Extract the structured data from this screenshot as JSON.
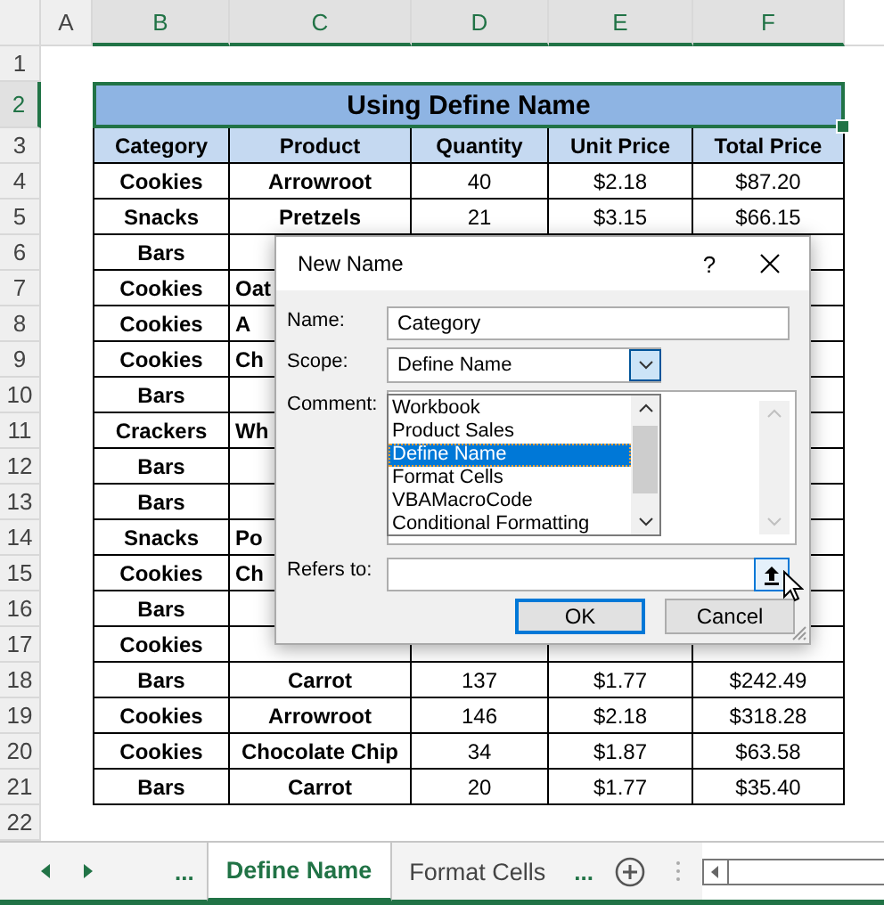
{
  "sheet": {
    "columns": [
      {
        "label": "A",
        "selected": false
      },
      {
        "label": "B",
        "selected": true
      },
      {
        "label": "C",
        "selected": true
      },
      {
        "label": "D",
        "selected": true
      },
      {
        "label": "E",
        "selected": true
      },
      {
        "label": "F",
        "selected": true
      }
    ],
    "row_numbers": [
      {
        "label": "1",
        "selected": false
      },
      {
        "label": "2",
        "selected": true
      },
      {
        "label": "3",
        "selected": false
      },
      {
        "label": "4",
        "selected": false
      },
      {
        "label": "5",
        "selected": false
      },
      {
        "label": "6",
        "selected": false
      },
      {
        "label": "7",
        "selected": false
      },
      {
        "label": "8",
        "selected": false
      },
      {
        "label": "9",
        "selected": false
      },
      {
        "label": "10",
        "selected": false
      },
      {
        "label": "11",
        "selected": false
      },
      {
        "label": "12",
        "selected": false
      },
      {
        "label": "13",
        "selected": false
      },
      {
        "label": "14",
        "selected": false
      },
      {
        "label": "15",
        "selected": false
      },
      {
        "label": "16",
        "selected": false
      },
      {
        "label": "17",
        "selected": false
      },
      {
        "label": "18",
        "selected": false
      },
      {
        "label": "19",
        "selected": false
      },
      {
        "label": "20",
        "selected": false
      },
      {
        "label": "21",
        "selected": false
      },
      {
        "label": "22",
        "selected": false
      }
    ],
    "table": {
      "title": "Using Define Name",
      "columns": [
        "Category",
        "Product",
        "Quantity",
        "Unit Price",
        "Total Price"
      ],
      "rows": [
        [
          "Cookies",
          "Arrowroot",
          "40",
          "$2.18",
          "$87.20"
        ],
        [
          "Snacks",
          "Pretzels",
          "21",
          "$3.15",
          "$66.15"
        ],
        [
          "Bars"
        ],
        [
          "Cookies",
          "Oat"
        ],
        [
          "Cookies",
          "A"
        ],
        [
          "Cookies",
          "Ch"
        ],
        [
          "Bars"
        ],
        [
          "Crackers",
          "Wh"
        ],
        [
          "Bars"
        ],
        [
          "Bars"
        ],
        [
          "Snacks",
          "Po"
        ],
        [
          "Cookies",
          "Ch"
        ],
        [
          "Bars"
        ],
        [
          "Cookies"
        ],
        [
          "Bars",
          "Carrot",
          "137",
          "$1.77",
          "$242.49"
        ],
        [
          "Cookies",
          "Arrowroot",
          "146",
          "$2.18",
          "$318.28"
        ],
        [
          "Cookies",
          "Chocolate Chip",
          "34",
          "$1.87",
          "$63.58"
        ],
        [
          "Bars",
          "Carrot",
          "20",
          "$1.77",
          "$35.40"
        ]
      ]
    }
  },
  "dialog": {
    "title": "New Name",
    "help": "?",
    "name_label": "Name:",
    "name_value": "Category",
    "scope_label": "Scope:",
    "scope_value": "Define Name",
    "scope_options": [
      {
        "label": "Workbook",
        "selected": false
      },
      {
        "label": "Product Sales",
        "selected": false
      },
      {
        "label": "Define Name",
        "selected": true
      },
      {
        "label": "Format Cells",
        "selected": false
      },
      {
        "label": "VBAMacroCode",
        "selected": false
      },
      {
        "label": "Conditional Formatting",
        "selected": false
      }
    ],
    "comment_label": "Comment:",
    "refers_label": "Refers to:",
    "buttons": [
      {
        "label": "OK",
        "default": true
      },
      {
        "label": "Cancel",
        "default": false
      }
    ]
  },
  "sheet_tabs": {
    "more_left": "...",
    "tabs": [
      {
        "label": "Define Name",
        "selected": true
      },
      {
        "label": "Format Cells",
        "selected": false
      }
    ],
    "more_right": "..."
  }
}
